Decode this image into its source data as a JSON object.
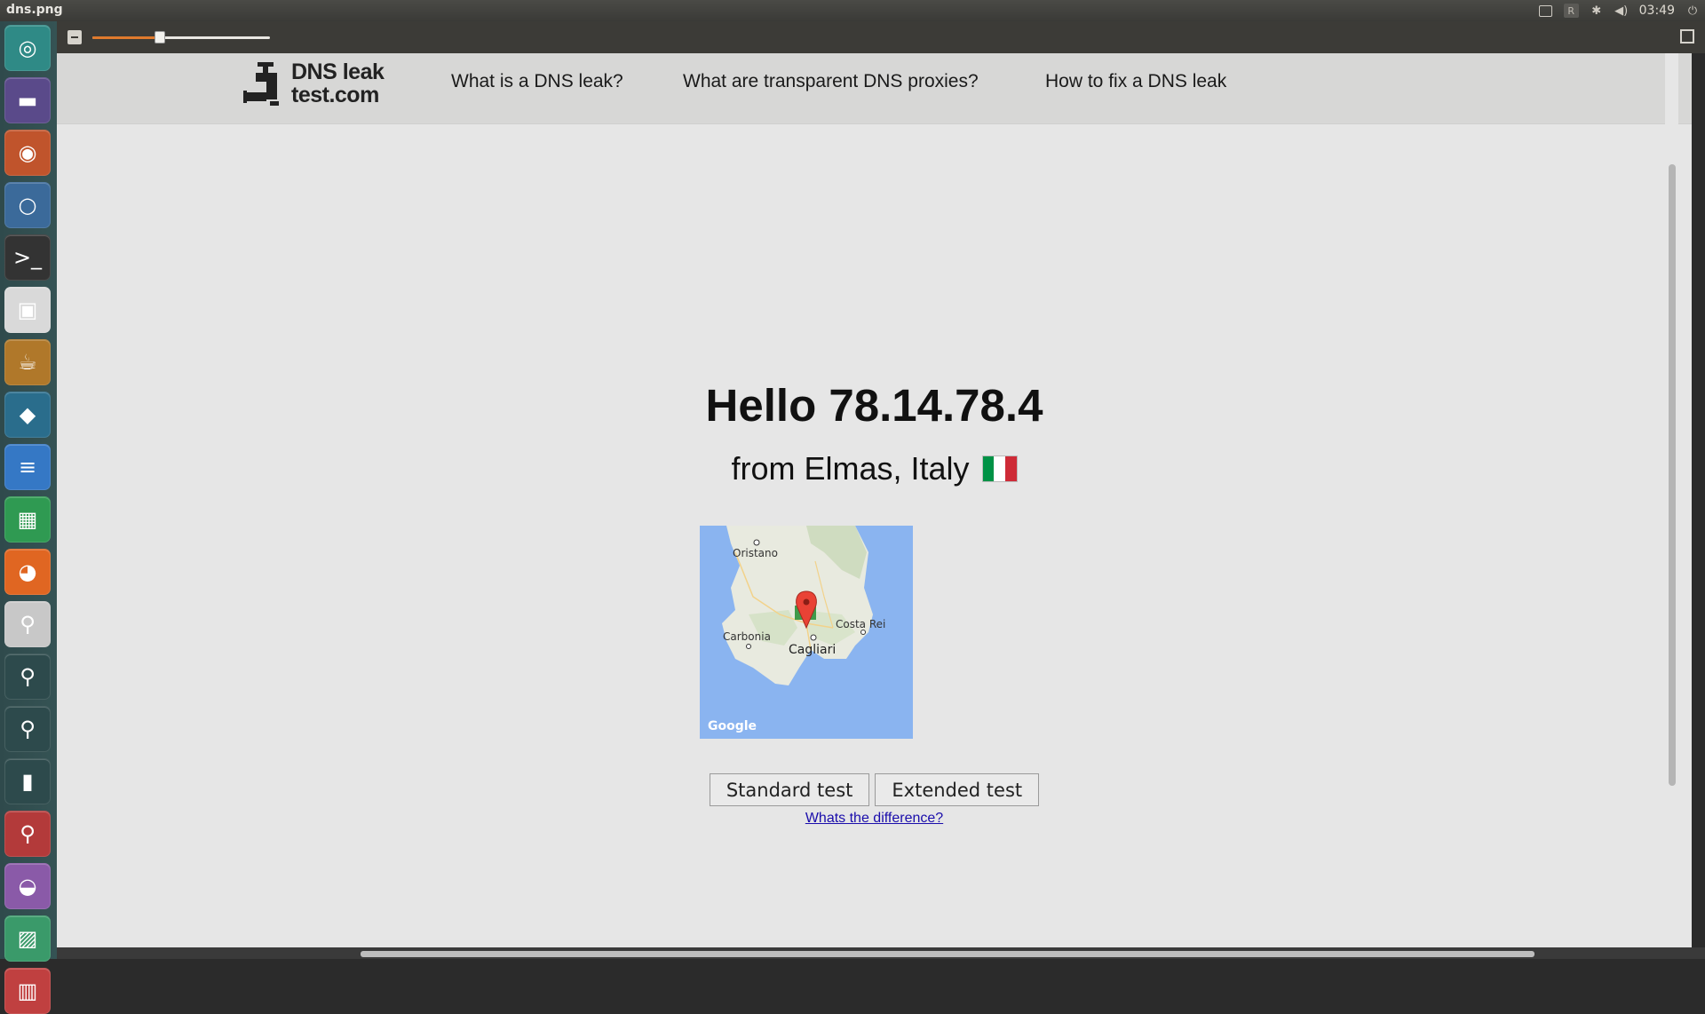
{
  "system": {
    "window_title": "dns.png",
    "clock": "03:49",
    "tray_keyboard": "R",
    "tray_icons": [
      "display-icon",
      "keyboard-icon",
      "bluetooth-icon",
      "volume-icon",
      "session-icon"
    ]
  },
  "launcher": {
    "items": [
      {
        "name": "dash-home-icon",
        "bg": "#2f8a86",
        "glyph": "◎"
      },
      {
        "name": "files-icon",
        "bg": "#5a4a8a",
        "glyph": "▬"
      },
      {
        "name": "web-browser-icon",
        "bg": "#c0542c",
        "glyph": "◉"
      },
      {
        "name": "chromium-icon",
        "bg": "#3b6a9a",
        "glyph": "○"
      },
      {
        "name": "terminal-icon",
        "bg": "#333333",
        "glyph": ">_"
      },
      {
        "name": "remote-desktop-icon",
        "bg": "#d9d9d9",
        "glyph": "▣"
      },
      {
        "name": "java-icon",
        "bg": "#b0782a",
        "glyph": "☕"
      },
      {
        "name": "kodi-icon",
        "bg": "#2a6d8c",
        "glyph": "◆"
      },
      {
        "name": "text-editor-icon",
        "bg": "#3578c5",
        "glyph": "≡"
      },
      {
        "name": "spreadsheet-icon",
        "bg": "#2f9a52",
        "glyph": "▦"
      },
      {
        "name": "firefox-icon",
        "bg": "#e06622",
        "glyph": "◕"
      },
      {
        "name": "settings-toggle-icon",
        "bg": "#c8c8c8",
        "glyph": "⚲"
      },
      {
        "name": "vpn-search-icon",
        "bg": "#2d4a4c",
        "glyph": "⚲"
      },
      {
        "name": "vpn-search-icon-2",
        "bg": "#2d4a4c",
        "glyph": "⚲"
      },
      {
        "name": "usb-lock-icon",
        "bg": "#2d4a4c",
        "glyph": "▮"
      },
      {
        "name": "vpn-red-icon",
        "bg": "#b33a3a",
        "glyph": "⚲"
      },
      {
        "name": "installer-icon",
        "bg": "#8a5aa8",
        "glyph": "◒"
      },
      {
        "name": "image-viewer-icon",
        "bg": "#3a9a6a",
        "glyph": "▨"
      },
      {
        "name": "trash-icon",
        "bg": "#c04040",
        "glyph": "▥"
      }
    ]
  },
  "viewer": {
    "zoom_level": 0.38
  },
  "site": {
    "logo_line1": "DNS leak",
    "logo_line2": "test.com",
    "nav": [
      {
        "label": "What is a DNS leak?"
      },
      {
        "label": "What are transparent DNS proxies?"
      },
      {
        "label": "How to fix a DNS leak"
      }
    ],
    "hello": "Hello 78.14.78.4",
    "location": "from Elmas, Italy",
    "flag_colors": [
      "#009246",
      "#ffffff",
      "#ce2b37"
    ],
    "map": {
      "labels": [
        {
          "text": "Oristano"
        },
        {
          "text": "Carbonia"
        },
        {
          "text": "Costa Rei"
        },
        {
          "text": "Cagliari"
        },
        {
          "text": "Google"
        }
      ]
    },
    "buttons": {
      "standard": "Standard test",
      "extended": "Extended test"
    },
    "difference_link": "Whats the difference?"
  }
}
